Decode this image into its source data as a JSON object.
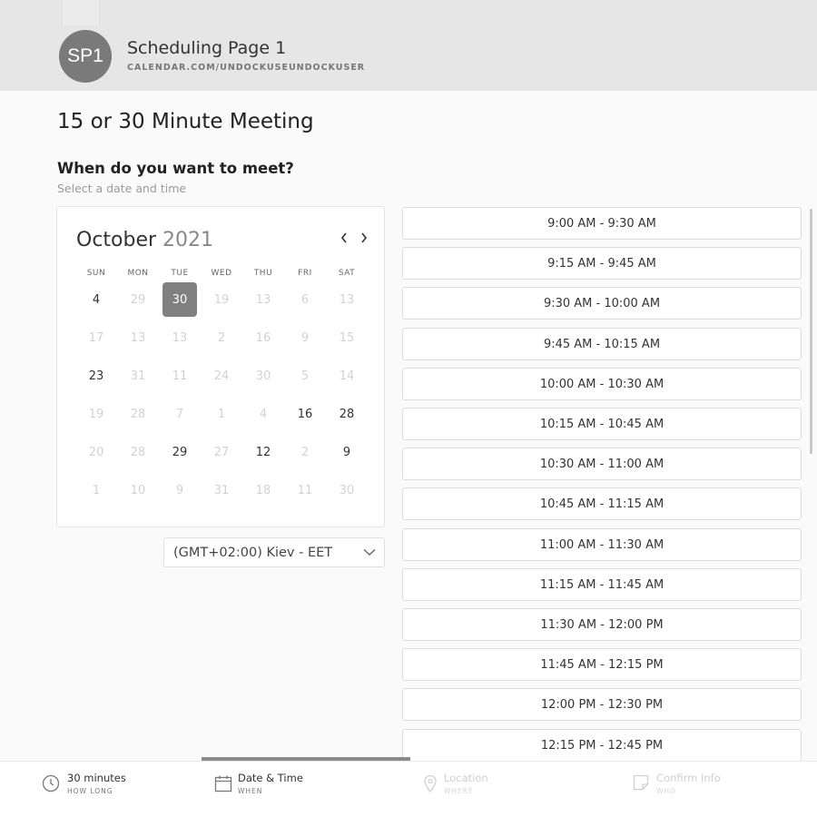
{
  "header": {
    "avatar_initials": "SP1",
    "page_name": "Scheduling Page 1",
    "page_url": "CALENDAR.COM/UNDOCKUSEUNDOCKUSER"
  },
  "meeting_title": "15 or 30 Minute Meeting",
  "prompt": {
    "question": "When do you want to meet?",
    "subtitle": "Select a date and time"
  },
  "calendar": {
    "month": "October",
    "year": "2021",
    "prev_icon": "chevron-left-icon",
    "next_icon": "chevron-right-icon",
    "weekdays": [
      "SUN",
      "MON",
      "TUE",
      "WED",
      "THU",
      "FRI",
      "SAT"
    ],
    "selected_day": "30",
    "weeks": [
      [
        {
          "d": "4",
          "a": true
        },
        {
          "d": "29",
          "a": false
        },
        {
          "d": "30",
          "a": true,
          "s": true
        },
        {
          "d": "19",
          "a": false
        },
        {
          "d": "13",
          "a": false
        },
        {
          "d": "6",
          "a": false
        },
        {
          "d": "13",
          "a": false
        }
      ],
      [
        {
          "d": "17",
          "a": false
        },
        {
          "d": "13",
          "a": false
        },
        {
          "d": "13",
          "a": false
        },
        {
          "d": "2",
          "a": false
        },
        {
          "d": "16",
          "a": false
        },
        {
          "d": "9",
          "a": false
        },
        {
          "d": "15",
          "a": false
        }
      ],
      [
        {
          "d": "23",
          "a": true
        },
        {
          "d": "31",
          "a": false
        },
        {
          "d": "11",
          "a": false
        },
        {
          "d": "24",
          "a": false
        },
        {
          "d": "30",
          "a": false
        },
        {
          "d": "5",
          "a": false
        },
        {
          "d": "14",
          "a": false
        }
      ],
      [
        {
          "d": "19",
          "a": false
        },
        {
          "d": "28",
          "a": false
        },
        {
          "d": "7",
          "a": false
        },
        {
          "d": "1",
          "a": false
        },
        {
          "d": "4",
          "a": false
        },
        {
          "d": "16",
          "a": true
        },
        {
          "d": "28",
          "a": true
        }
      ],
      [
        {
          "d": "20",
          "a": false
        },
        {
          "d": "28",
          "a": false
        },
        {
          "d": "29",
          "a": true
        },
        {
          "d": "27",
          "a": false
        },
        {
          "d": "12",
          "a": true
        },
        {
          "d": "2",
          "a": false
        },
        {
          "d": "9",
          "a": true
        }
      ],
      [
        {
          "d": "1",
          "a": false
        },
        {
          "d": "10",
          "a": false
        },
        {
          "d": "9",
          "a": false
        },
        {
          "d": "31",
          "a": false
        },
        {
          "d": "18",
          "a": false
        },
        {
          "d": "11",
          "a": false
        },
        {
          "d": "30",
          "a": false
        }
      ]
    ]
  },
  "timezone": {
    "selected": "(GMT+02:00) Kiev - EET",
    "icon": "chevron-down-icon"
  },
  "time_slots": [
    "9:00 AM - 9:30 AM",
    "9:15 AM - 9:45 AM",
    "9:30 AM - 10:00 AM",
    "9:45 AM - 10:15 AM",
    "10:00 AM - 10:30 AM",
    "10:15 AM - 10:45 AM",
    "10:30 AM - 11:00 AM",
    "10:45 AM - 11:15 AM",
    "11:00 AM - 11:30 AM",
    "11:15 AM - 11:45 AM",
    "11:30 AM - 12:00 PM",
    "11:45 AM - 12:15 PM",
    "12:00 PM - 12:30 PM",
    "12:15 PM - 12:45 PM"
  ],
  "footer": {
    "active_step": "datetime",
    "steps": {
      "duration": {
        "title": "30 minutes",
        "sub": "HOW LONG",
        "icon": "clock-icon"
      },
      "datetime": {
        "title": "Date & Time",
        "sub": "WHEN",
        "icon": "calendar-icon"
      },
      "location": {
        "title": "Location",
        "sub": "WHERE",
        "icon": "location-pin-icon"
      },
      "confirm": {
        "title": "Confirm Info",
        "sub": "WHO",
        "icon": "note-icon"
      }
    }
  },
  "colors": {
    "header_bg": "#e6e6e6",
    "avatar_bg": "#7a7a7a",
    "selected_day_bg": "#808080",
    "progress_bar": "#8a8a8a"
  }
}
